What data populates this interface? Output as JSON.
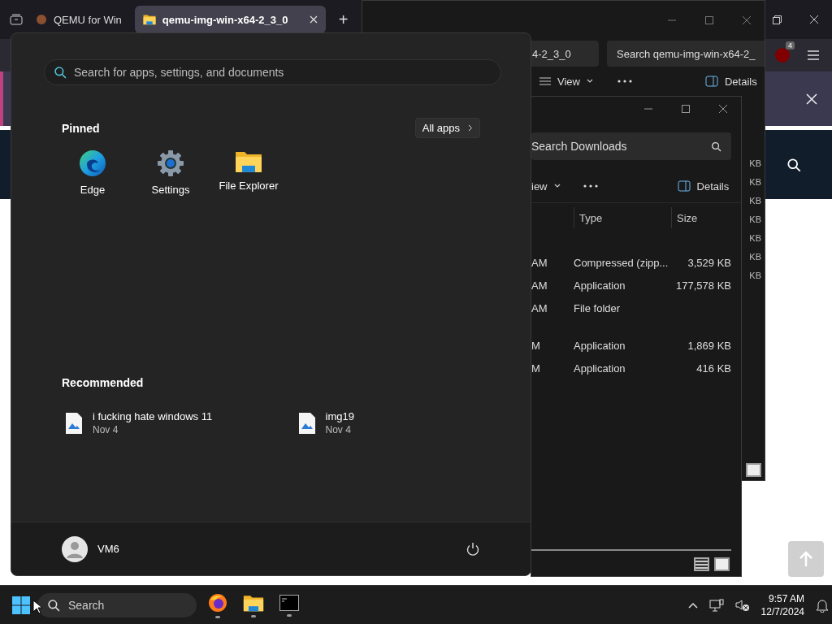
{
  "browser": {
    "tabs": [
      {
        "title": "QEMU for Win",
        "selected": false
      },
      {
        "title": "qemu-img-win-x64-2_3_0",
        "selected": true
      }
    ],
    "new_tab": "+",
    "extension_badge": "4"
  },
  "explorer_back": {
    "address": "4-2_3_0",
    "search_placeholder": "Search qemu-img-win-x64-2_",
    "view": "View",
    "details": "Details",
    "size_column": [
      "KB",
      "KB",
      "KB",
      "KB",
      "KB",
      "KB",
      "KB"
    ]
  },
  "explorer_front": {
    "search_placeholder": "Search Downloads",
    "view": "iew",
    "details": "Details",
    "columns": [
      "Type",
      "Size"
    ],
    "groups": [
      {
        "rows": [
          {
            "date": "AM",
            "type": "Compressed (zipp...",
            "size": "3,529 KB"
          },
          {
            "date": "AM",
            "type": "Application",
            "size": "177,578 KB"
          },
          {
            "date": "AM",
            "type": "File folder"
          }
        ]
      },
      {
        "rows": [
          {
            "date": "M",
            "type": "Application",
            "size": "1,869 KB"
          },
          {
            "date": "M",
            "type": "Application",
            "size": "416 KB"
          }
        ]
      }
    ]
  },
  "start_menu": {
    "search_placeholder": "Search for apps, settings, and documents",
    "pinned_title": "Pinned",
    "all_apps": "All apps",
    "pinned": [
      {
        "kind": "edge",
        "label": "Edge"
      },
      {
        "kind": "settings",
        "label": "Settings"
      },
      {
        "kind": "folder",
        "label": "File Explorer"
      }
    ],
    "recommended_title": "Recommended",
    "recommended": [
      {
        "name": "i fucking hate windows 11",
        "date": "Nov 4"
      },
      {
        "name": "img19",
        "date": "Nov 4"
      }
    ],
    "user": "VM6"
  },
  "taskbar": {
    "search_placeholder": "Search",
    "apps": [
      {
        "kind": "firefox",
        "running": true
      },
      {
        "kind": "folder",
        "running": true
      },
      {
        "kind": "terminal",
        "running": true
      }
    ],
    "time": "9:57 AM",
    "date": "12/7/2024"
  }
}
